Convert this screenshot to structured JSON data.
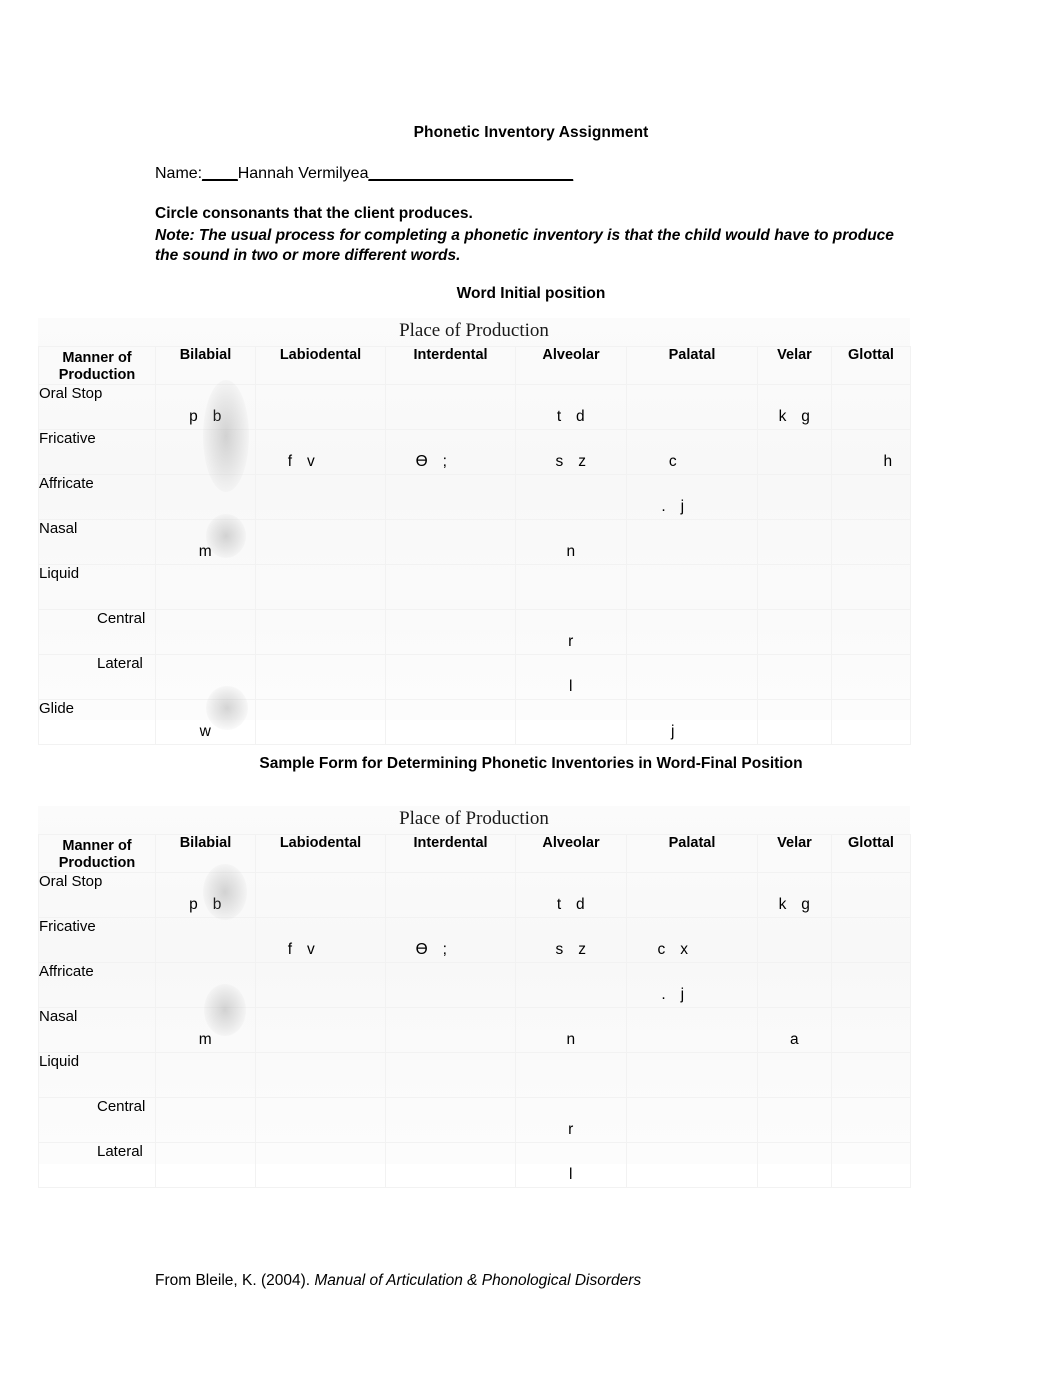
{
  "document": {
    "title": "Phonetic Inventory Assignment",
    "name_label": "Name:",
    "name_blank_before": "____",
    "name_value": "Hannah Vermilyea",
    "name_blank_after": "_______________________",
    "instruction": "Circle consonants that the client produces.",
    "note": "Note: The usual process for completing a phonetic inventory is that the child would have to produce the sound in two or more different words.",
    "footer_prefix": "From Bleile, K. (2004). ",
    "footer_italic": "Manual of Articulation & Phonological Disorders"
  },
  "columns": {
    "manner_header_line1": "Manner of",
    "manner_header_line2": "Production",
    "place_heading": "Place of Production",
    "places": [
      "Bilabial",
      "Labiodental",
      "Interdental",
      "Alveolar",
      "Palatal",
      "Velar",
      "Glottal"
    ]
  },
  "table_initial": {
    "title": "Word Initial position",
    "place_heading": "Place of Production",
    "rows": [
      {
        "manner": "Oral Stop",
        "indent": false,
        "cells": [
          "p   b",
          "",
          "",
          "t   d",
          "",
          "k   g",
          ""
        ]
      },
      {
        "manner": "Fricative",
        "indent": false,
        "cells": [
          "",
          "f   v",
          "Ɵ   ;",
          "s   z",
          "c",
          "",
          "h"
        ]
      },
      {
        "manner": "Affricate",
        "indent": false,
        "cells": [
          "",
          "",
          "",
          "",
          ".   j",
          "",
          ""
        ]
      },
      {
        "manner": "Nasal",
        "indent": false,
        "cells": [
          "m",
          "",
          "",
          "n",
          "",
          "",
          ""
        ]
      },
      {
        "manner": "Liquid",
        "indent": false,
        "cells": [
          "",
          "",
          "",
          "",
          "",
          "",
          ""
        ]
      },
      {
        "manner": "Central",
        "indent": true,
        "cells": [
          "",
          "",
          "",
          "r",
          "",
          "",
          ""
        ]
      },
      {
        "manner": "Lateral",
        "indent": true,
        "cells": [
          "",
          "",
          "",
          "l",
          "",
          "",
          ""
        ]
      },
      {
        "manner": "Glide",
        "indent": false,
        "cells": [
          "w",
          "",
          "",
          "",
          "j",
          "",
          ""
        ]
      }
    ]
  },
  "table_final": {
    "title": "Sample Form for Determining Phonetic Inventories in Word-Final Position",
    "place_heading": "Place of Production",
    "rows": [
      {
        "manner": "Oral Stop",
        "indent": false,
        "cells": [
          "p   b",
          "",
          "",
          "t   d",
          "",
          "k   g",
          ""
        ]
      },
      {
        "manner": "Fricative",
        "indent": false,
        "cells": [
          "",
          "f   v",
          "Ɵ   ;",
          "s   z",
          "c   x",
          "",
          ""
        ]
      },
      {
        "manner": "Affricate",
        "indent": false,
        "cells": [
          "",
          "",
          "",
          "",
          ".   j",
          "",
          ""
        ]
      },
      {
        "manner": "Nasal",
        "indent": false,
        "cells": [
          "m",
          "",
          "",
          "n",
          "",
          "a",
          ""
        ]
      },
      {
        "manner": "Liquid",
        "indent": false,
        "cells": [
          "",
          "",
          "",
          "",
          "",
          "",
          ""
        ]
      },
      {
        "manner": "Central",
        "indent": true,
        "cells": [
          "",
          "",
          "",
          "r",
          "",
          "",
          ""
        ]
      },
      {
        "manner": "Lateral",
        "indent": true,
        "cells": [
          "",
          "",
          "",
          "l",
          "",
          "",
          ""
        ]
      }
    ]
  }
}
